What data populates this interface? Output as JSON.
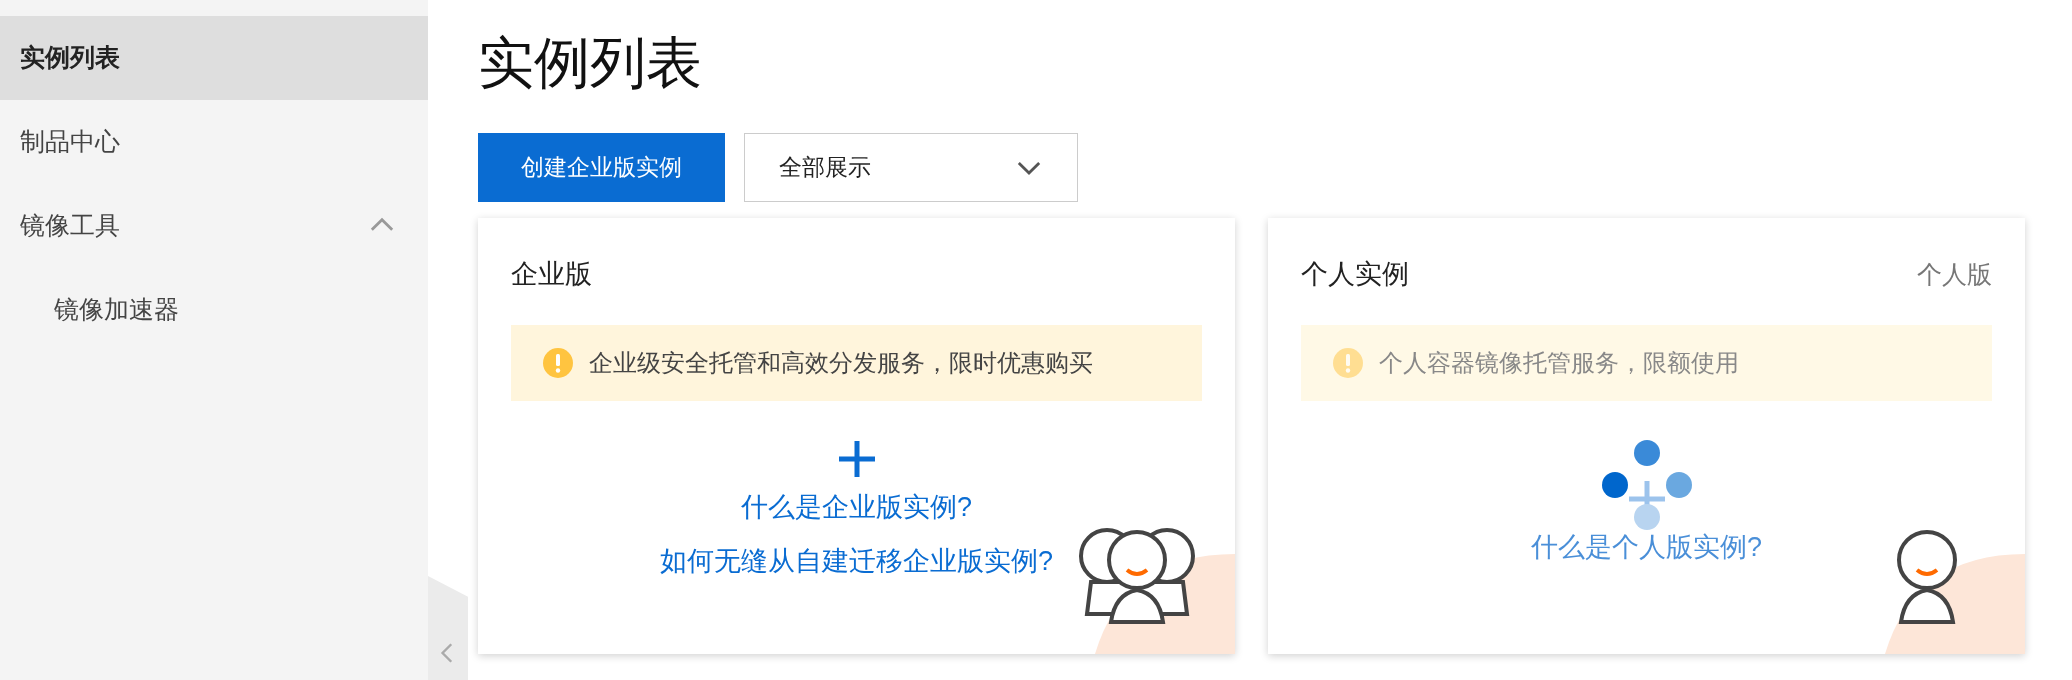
{
  "sidebar": {
    "items": [
      {
        "label": "实例列表",
        "selected": true
      },
      {
        "label": "制品中心",
        "selected": false
      },
      {
        "label": "镜像工具",
        "selected": false,
        "expanded": true,
        "children": [
          {
            "label": "镜像加速器",
            "selected": false
          }
        ]
      }
    ]
  },
  "page_title": "实例列表",
  "toolbar": {
    "create_button": "创建企业版实例",
    "filter": {
      "value": "全部展示"
    }
  },
  "cards": [
    {
      "title": "企业版",
      "alert": "企业级安全托管和高效分发服务，限时优惠购买",
      "links": [
        "什么是企业版实例?",
        "如何无缝从自建迁移企业版实例?"
      ],
      "loading": false
    },
    {
      "title": "个人实例",
      "tag": "个人版",
      "alert": "个人容器镜像托管服务，限额使用",
      "links": [
        "什么是个人版实例?"
      ],
      "loading": true
    }
  ]
}
